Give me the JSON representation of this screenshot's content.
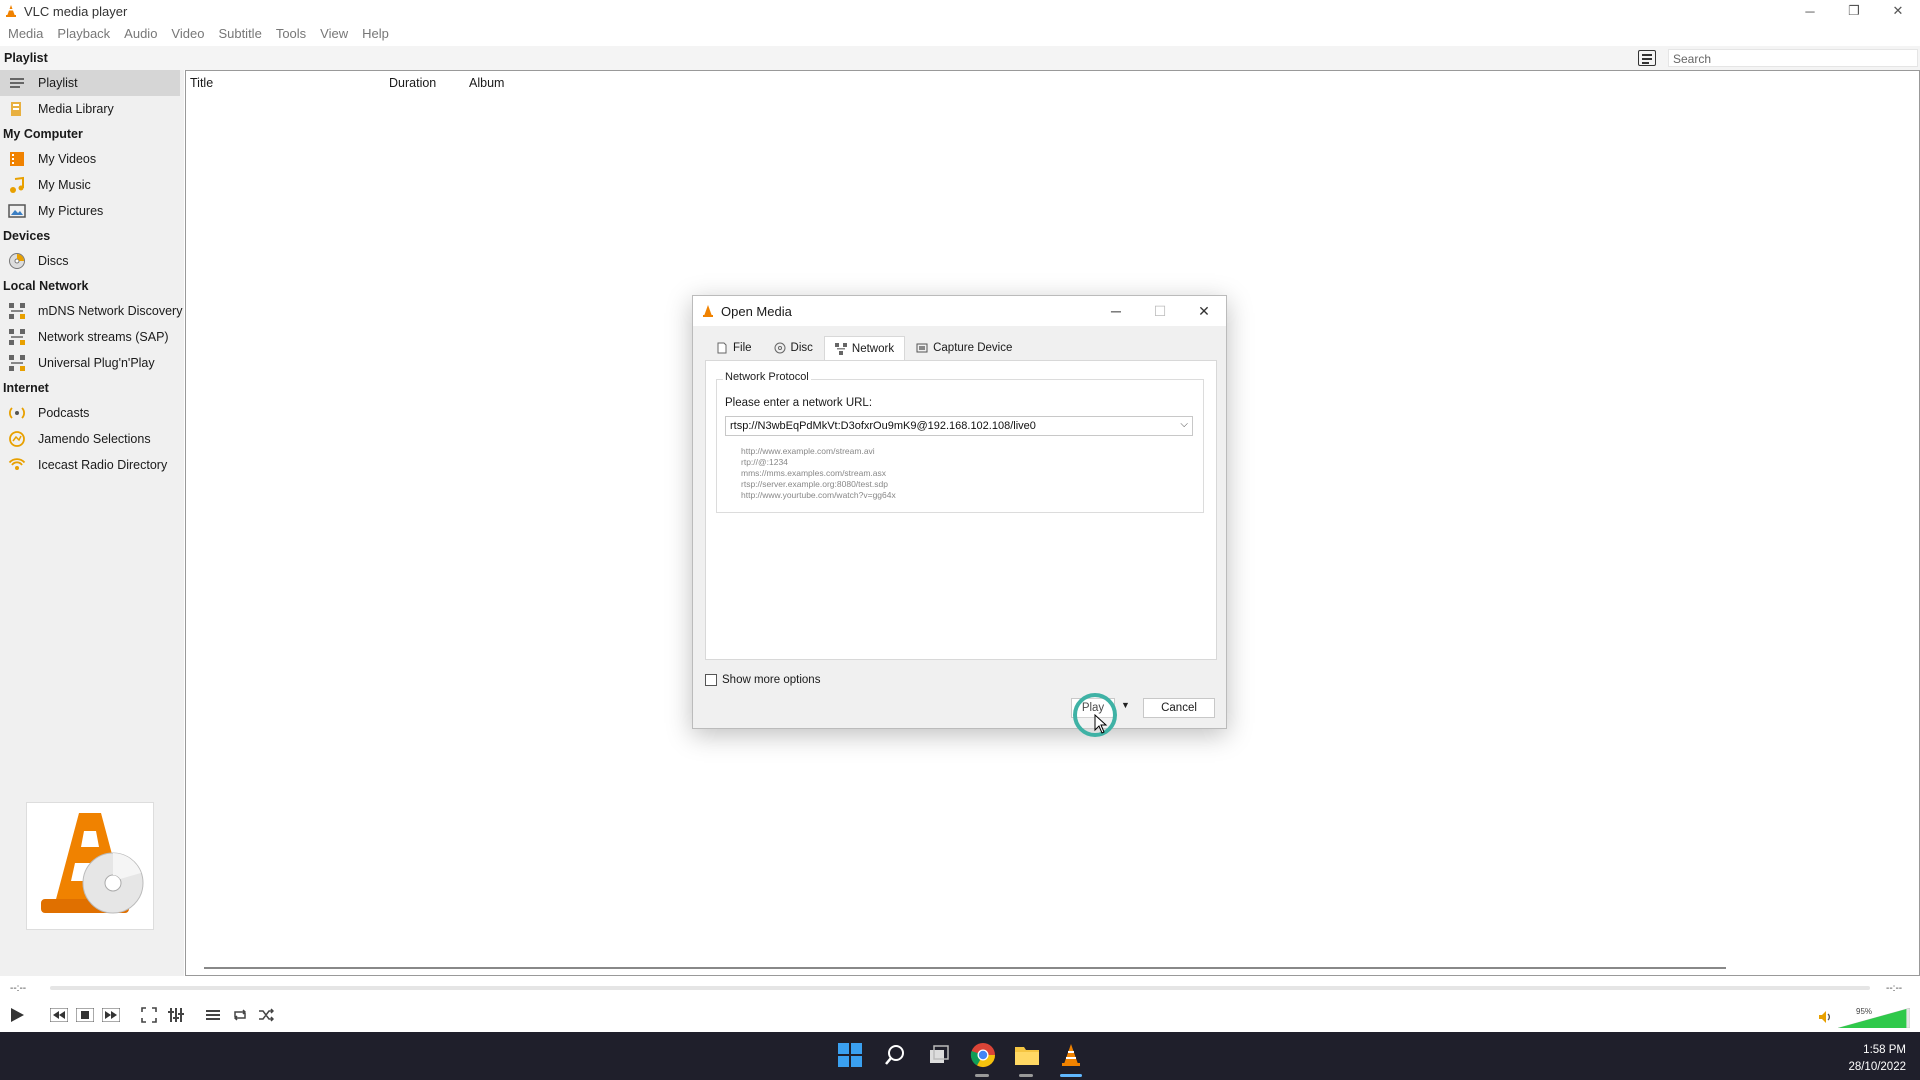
{
  "app": {
    "title": "VLC media player",
    "window_controls": {
      "minimize": "─",
      "maximize": "❐",
      "close": "✕"
    }
  },
  "menu": [
    "Media",
    "Playback",
    "Audio",
    "Video",
    "Subtitle",
    "Tools",
    "View",
    "Help"
  ],
  "header": {
    "section": "Playlist",
    "search_placeholder": "Search"
  },
  "sidebar": {
    "items": [
      {
        "type": "item",
        "label": "Playlist",
        "icon": "playlist-icon",
        "active": true
      },
      {
        "type": "item",
        "label": "Media Library",
        "icon": "media-library-icon"
      },
      {
        "type": "section",
        "label": "My Computer"
      },
      {
        "type": "item",
        "label": "My Videos",
        "icon": "videos-icon"
      },
      {
        "type": "item",
        "label": "My Music",
        "icon": "music-icon"
      },
      {
        "type": "item",
        "label": "My Pictures",
        "icon": "pictures-icon"
      },
      {
        "type": "section",
        "label": "Devices"
      },
      {
        "type": "item",
        "label": "Discs",
        "icon": "disc-icon"
      },
      {
        "type": "section",
        "label": "Local Network"
      },
      {
        "type": "item",
        "label": "mDNS Network Discovery",
        "icon": "network-icon"
      },
      {
        "type": "item",
        "label": "Network streams (SAP)",
        "icon": "network-icon"
      },
      {
        "type": "item",
        "label": "Universal Plug'n'Play",
        "icon": "network-icon"
      },
      {
        "type": "section",
        "label": "Internet"
      },
      {
        "type": "item",
        "label": "Podcasts",
        "icon": "podcast-icon"
      },
      {
        "type": "item",
        "label": "Jamendo Selections",
        "icon": "jamendo-icon"
      },
      {
        "type": "item",
        "label": "Icecast Radio Directory",
        "icon": "radio-icon"
      }
    ]
  },
  "playlist": {
    "columns": [
      "Title",
      "Duration",
      "Album"
    ]
  },
  "dialog": {
    "title": "Open Media",
    "tabs": [
      {
        "label": "File",
        "icon": "file-icon"
      },
      {
        "label": "Disc",
        "icon": "disc-icon"
      },
      {
        "label": "Network",
        "icon": "network-icon",
        "active": true
      },
      {
        "label": "Capture Device",
        "icon": "capture-device-icon"
      }
    ],
    "group_title": "Network Protocol",
    "url_label": "Please enter a network URL:",
    "url_value": "rtsp://N3wbEqPdMkVt:D3ofxrOu9mK9@192.168.102.108/live0",
    "examples": [
      "http://www.example.com/stream.avi",
      "rtp://@:1234",
      "mms://mms.examples.com/stream.asx",
      "rtsp://server.example.org:8080/test.sdp",
      "http://www.yourtube.com/watch?v=gg64x"
    ],
    "show_more": "Show more options",
    "play": "Play",
    "cancel": "Cancel"
  },
  "controls": {
    "time_elapsed": "--:--",
    "time_total": "--:--",
    "volume_pct": "95%",
    "volume_level": 0.95
  },
  "taskbar": {
    "time": "1:58 PM",
    "date": "28/10/2022"
  },
  "colors": {
    "vlc_orange": "#f08200",
    "volume_green": "#2fc94a",
    "taskbar_bg": "#1f1f2b",
    "click_ring": "#3fb2a5"
  }
}
